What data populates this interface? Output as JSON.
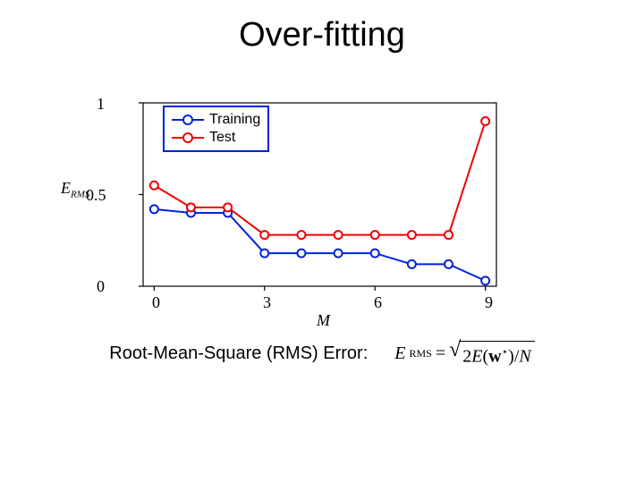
{
  "title": "Over-fitting",
  "footer_label": "Root-Mean-Square (RMS) Error:",
  "eqn": {
    "lhs_E": "E",
    "lhs_sub": "RMS",
    "eq": "=",
    "two": "2",
    "Ew": "E",
    "open": "(",
    "w": "w",
    "star": "⋆",
    "close": ")",
    "slash": "/",
    "N": "N"
  },
  "legend": {
    "training": "Training",
    "test": "Test"
  },
  "axis": {
    "x_label": "M",
    "y_label": "E_RMS",
    "x_ticks": [
      "0",
      "3",
      "6",
      "9"
    ],
    "y_ticks": [
      "0",
      "0.5",
      "1"
    ]
  },
  "colors": {
    "training": "#0022dd",
    "test": "#ee0000",
    "axis": "#000000",
    "legend_border": "#0022dd"
  },
  "chart_data": {
    "type": "line",
    "title": "Over-fitting",
    "xlabel": "M",
    "ylabel": "E_RMS",
    "xlim": [
      -0.3,
      9.3
    ],
    "ylim": [
      0,
      1
    ],
    "x": [
      0,
      1,
      2,
      3,
      4,
      5,
      6,
      7,
      8,
      9
    ],
    "series": [
      {
        "name": "Training",
        "color": "#0022dd",
        "values": [
          0.42,
          0.4,
          0.4,
          0.18,
          0.18,
          0.18,
          0.18,
          0.12,
          0.12,
          0.03
        ]
      },
      {
        "name": "Test",
        "color": "#ee0000",
        "values": [
          0.55,
          0.43,
          0.43,
          0.28,
          0.28,
          0.28,
          0.28,
          0.28,
          0.28,
          0.9
        ]
      }
    ]
  }
}
